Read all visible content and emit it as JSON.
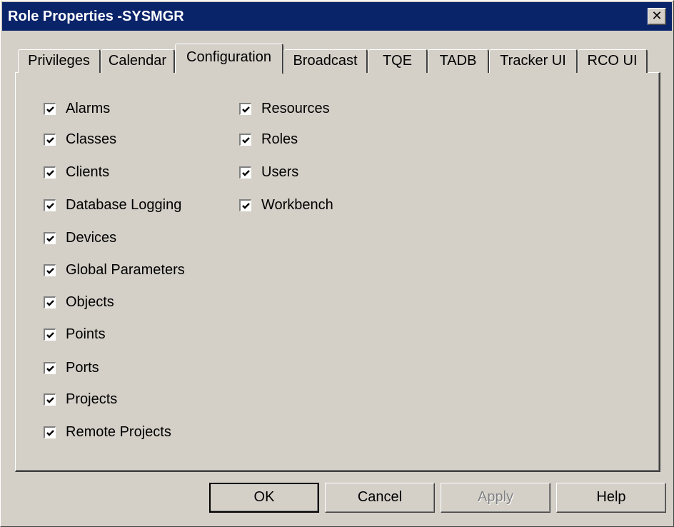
{
  "window": {
    "title": "Role Properties -SYSMGR",
    "close_glyph": "✕"
  },
  "tabs": [
    {
      "label": "Privileges"
    },
    {
      "label": "Calendar"
    },
    {
      "label": "Configuration",
      "active": true
    },
    {
      "label": "Broadcast"
    },
    {
      "label": "TQE"
    },
    {
      "label": "TADB"
    },
    {
      "label": "Tracker UI"
    },
    {
      "label": "RCO UI"
    }
  ],
  "config": {
    "left": [
      {
        "label": "Alarms",
        "checked": true
      },
      {
        "label": "Classes",
        "checked": true
      },
      {
        "label": "Clients",
        "checked": true
      },
      {
        "label": "Database Logging",
        "checked": true
      },
      {
        "label": "Devices",
        "checked": true
      },
      {
        "label": "Global Parameters",
        "checked": true
      },
      {
        "label": "Objects",
        "checked": true
      },
      {
        "label": "Points",
        "checked": true
      },
      {
        "label": "Ports",
        "checked": true
      },
      {
        "label": "Projects",
        "checked": true
      },
      {
        "label": "Remote Projects",
        "checked": true
      }
    ],
    "right": [
      {
        "label": "Resources",
        "checked": true
      },
      {
        "label": "Roles",
        "checked": true
      },
      {
        "label": "Users",
        "checked": true
      },
      {
        "label": "Workbench",
        "checked": true
      }
    ]
  },
  "buttons": {
    "ok": "OK",
    "cancel": "Cancel",
    "apply": "Apply",
    "help": "Help"
  },
  "colors": {
    "title_bar": "#0a246a",
    "face": "#d4d0c8",
    "disabled_text": "#808080"
  }
}
